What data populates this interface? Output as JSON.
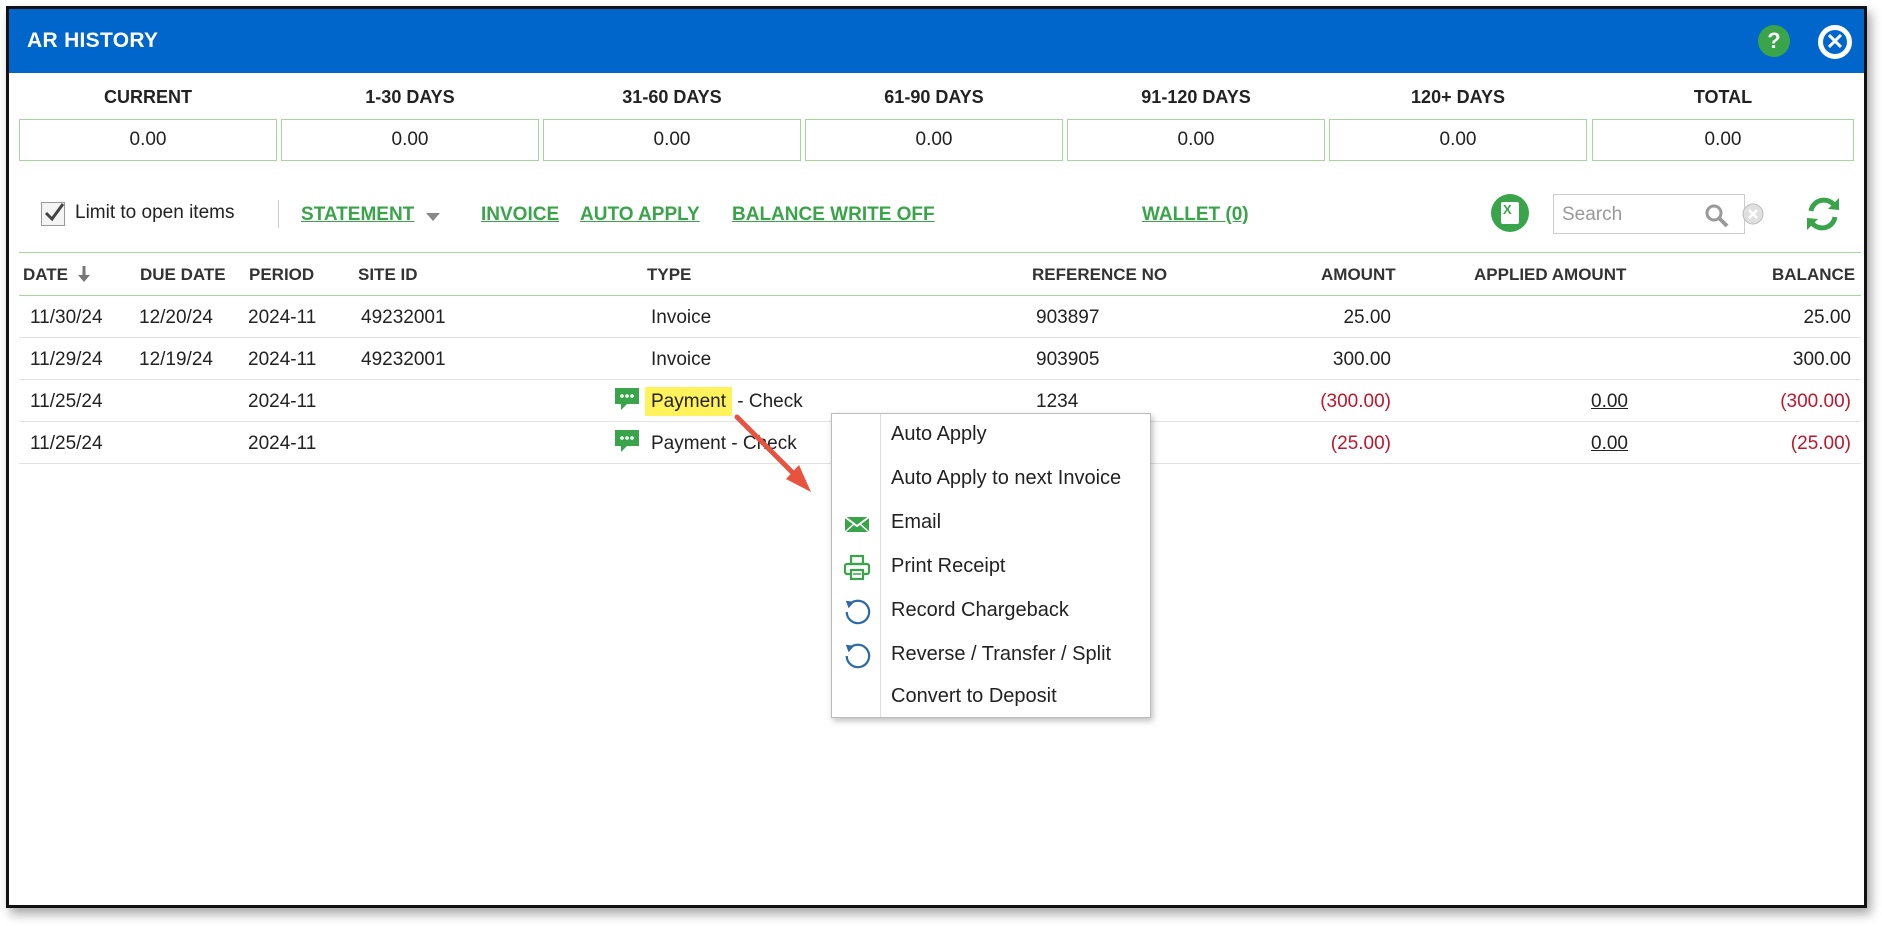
{
  "window": {
    "title": "AR HISTORY"
  },
  "aging": [
    {
      "label": "CURRENT",
      "value": "0.00"
    },
    {
      "label": "1-30 DAYS",
      "value": "0.00"
    },
    {
      "label": "31-60 DAYS",
      "value": "0.00"
    },
    {
      "label": "61-90 DAYS",
      "value": "0.00"
    },
    {
      "label": "91-120 DAYS",
      "value": "0.00"
    },
    {
      "label": "120+ DAYS",
      "value": "0.00"
    },
    {
      "label": "TOTAL",
      "value": "0.00"
    }
  ],
  "toolbar": {
    "limit_label": "Limit to open items",
    "limit_checked": true,
    "statement": "STATEMENT",
    "invoice": "INVOICE",
    "auto_apply": "AUTO APPLY",
    "balance_write_off": "BALANCE WRITE OFF",
    "wallet": "WALLET (0)",
    "search_placeholder": "Search",
    "link_color": "#3aa44a"
  },
  "grid": {
    "headers": [
      "DATE",
      "DUE DATE",
      "PERIOD",
      "SITE ID",
      "TYPE",
      "REFERENCE NO",
      "AMOUNT",
      "APPLIED AMOUNT",
      "BALANCE"
    ],
    "rows": [
      {
        "date": "11/30/24",
        "due": "12/20/24",
        "period": "2024-11",
        "site": "49232001",
        "type": "Invoice",
        "type_suffix": "",
        "ref": "903897",
        "amount": "25.00",
        "applied": "",
        "balance": "25.00"
      },
      {
        "date": "11/29/24",
        "due": "12/19/24",
        "period": "2024-11",
        "site": "49232001",
        "type": "Invoice",
        "type_suffix": "",
        "ref": "903905",
        "amount": "300.00",
        "applied": "",
        "balance": "300.00"
      },
      {
        "date": "11/25/24",
        "due": "",
        "period": "2024-11",
        "site": "",
        "type": "Payment",
        "type_suffix": " - Check",
        "ref": "1234",
        "amount": "(300.00)",
        "applied": "0.00",
        "balance": "(300.00)"
      },
      {
        "date": "11/25/24",
        "due": "",
        "period": "2024-11",
        "site": "",
        "type": "Payment",
        "type_suffix": " - Check",
        "ref": "",
        "amount": "(25.00)",
        "applied": "0.00",
        "balance": "(25.00)"
      }
    ]
  },
  "context_menu": {
    "items": [
      {
        "label": "Auto Apply",
        "icon": ""
      },
      {
        "label": "Auto Apply to next Invoice",
        "icon": ""
      },
      {
        "label": "Email",
        "icon": "envelope-icon"
      },
      {
        "label": "Print Receipt",
        "icon": "printer-icon"
      },
      {
        "label": "Record Chargeback",
        "icon": "undo-icon"
      },
      {
        "label": "Reverse / Transfer / Split",
        "icon": "undo-icon"
      },
      {
        "label": "Convert to Deposit",
        "icon": ""
      }
    ]
  },
  "colors": {
    "titlebar": "#0066cc",
    "accent_green": "#3aa44a",
    "negative_red": "#c0152c",
    "highlight_yellow": "#fff25a",
    "annotation_arrow": "#e8533f"
  }
}
